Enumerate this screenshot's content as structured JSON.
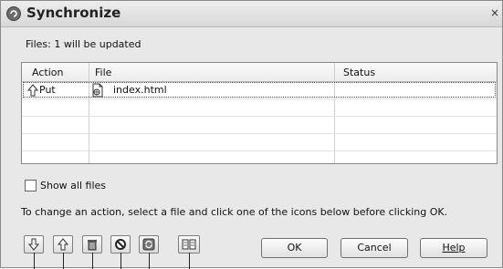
{
  "window": {
    "title": "Synchronize",
    "close_glyph": "×"
  },
  "summary": {
    "files_text": "Files: 1 will be updated"
  },
  "table": {
    "columns": [
      "Action",
      "File",
      "Status"
    ],
    "rows": [
      {
        "action": "Put",
        "action_icon": "up-arrow-icon",
        "file": "index.html",
        "file_icon": "html-file-icon",
        "status": ""
      }
    ]
  },
  "options": {
    "show_all_files_label": "Show all files",
    "show_all_files_checked": false
  },
  "instructions": "To change an action, select a file and click one of the icons below before clicking OK.",
  "toolbar": {
    "icons": [
      "get-icon",
      "put-icon",
      "delete-icon",
      "ignore-icon",
      "synchronized-icon",
      "compare-icon"
    ]
  },
  "buttons": {
    "ok": "OK",
    "cancel": "Cancel",
    "help": "Help"
  }
}
